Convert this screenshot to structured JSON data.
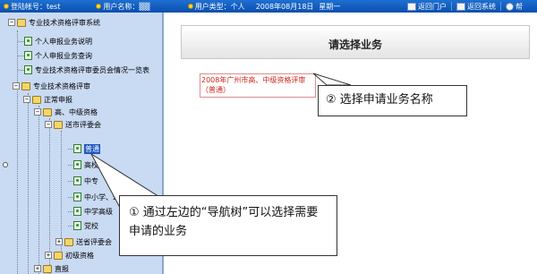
{
  "topbar": {
    "account_label": "登陆帐号：",
    "account_value": "test",
    "username_label": "用户名称：",
    "username_value": "▒▒",
    "usertype_label": "用户类型：",
    "usertype_value": "个人",
    "date": "2008年08月18日",
    "weekday": "星期一",
    "btn_portal": "返回门户",
    "btn_system": "返回系统",
    "btn_help": "帮"
  },
  "tree": {
    "root": "专业技术资格评审系统",
    "item_apply_desc": "个人申报业务说明",
    "item_query": "个人申报业务查询",
    "item_committee": "专业技术资格评审委员会情况一览表",
    "item_review": "专业技术资格评审",
    "item_normal": "正常申报",
    "item_senior_mid": "高、中级资格",
    "item_city": "送市评委会",
    "item_general": "普通",
    "item_univ": "高校",
    "item_secondary": "中专",
    "item_primary": "中小学、幼儿园",
    "item_middle_senior": "中学高级",
    "item_party": "党校",
    "item_province": "送省评委会",
    "item_junior": "初级资格",
    "item_direct": "直报"
  },
  "right": {
    "title": "请选择业务",
    "business_link": "2008年广州市高、中级资格评审（普通）"
  },
  "callouts": {
    "c1": "① 通过左边的“导航树”可以选择需要申请的业务",
    "c2": "② 选择申请业务名称"
  }
}
